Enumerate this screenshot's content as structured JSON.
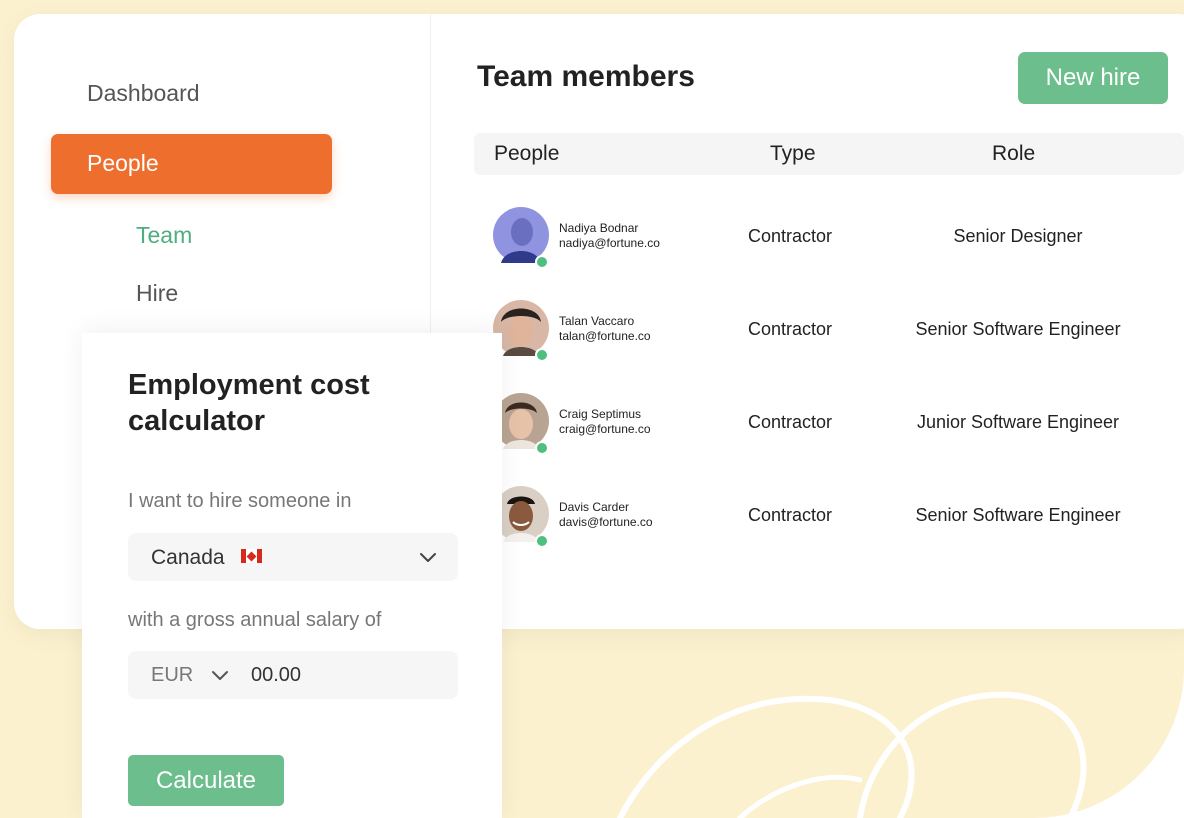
{
  "sidebar": {
    "items": [
      {
        "label": "Dashboard"
      },
      {
        "label": "People",
        "active": true
      },
      {
        "label": "Team",
        "sub": true,
        "active": true
      },
      {
        "label": "Hire",
        "sub": true
      }
    ]
  },
  "header": {
    "title": "Team members",
    "new_hire_label": "New hire"
  },
  "table": {
    "columns": [
      "People",
      "Type",
      "Role"
    ],
    "rows": [
      {
        "name": "Nadiya Bodnar",
        "email": "nadiya@fortune.co",
        "type": "Contractor",
        "role": "Senior Designer"
      },
      {
        "name": "Talan Vaccaro",
        "email": "talan@fortune.co",
        "type": "Contractor",
        "role": "Senior Software Engineer"
      },
      {
        "name": "Craig Septimus",
        "email": "craig@fortune.co",
        "type": "Contractor",
        "role": "Junior Software Engineer"
      },
      {
        "name": "Davis Carder",
        "email": "davis@fortune.co",
        "type": "Contractor",
        "role": "Senior Software Engineer"
      }
    ]
  },
  "calculator": {
    "title": "Employment cost calculator",
    "country_label": "I want to hire someone in",
    "country_value": "Canada",
    "country_flag": "canada-flag",
    "salary_label": "with a gross annual salary of",
    "currency": "EUR",
    "amount": "00.00",
    "calculate_label": "Calculate"
  },
  "colors": {
    "accent_orange": "#ee6e2d",
    "accent_green": "#6cbe8c",
    "active_link_green": "#4fae81",
    "background_cream": "#fbf1cf",
    "presence_green": "#4fbf7f"
  }
}
